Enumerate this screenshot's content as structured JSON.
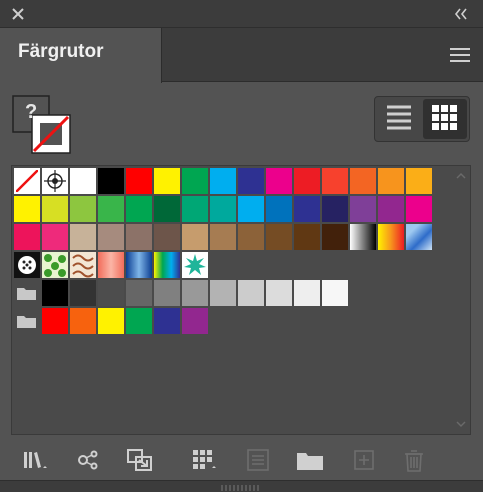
{
  "panel": {
    "title": "Färgrutor"
  },
  "icons": {
    "close": "close-icon",
    "collapse": "double-chevron-icon",
    "menu": "hamburger-menu-icon",
    "list_view": "list-view-icon",
    "grid_view": "grid-view-icon",
    "unknown_fill": "question-mark-icon"
  },
  "fill_stroke": {
    "fill_label": "?"
  },
  "swatch_rows": [
    [
      "none",
      "registration",
      "#ffffff",
      "#000000",
      "#ff0000",
      "#fff200",
      "#00a651",
      "#00aeef",
      "#2e3192",
      "#ec008c",
      "#ed1c24",
      "#f7412d",
      "#f36523",
      "#f7941d",
      "#fbae17"
    ],
    [
      "#fff200",
      "#d7df23",
      "#8dc63f",
      "#39b54a",
      "#00a651",
      "#006838",
      "#00a775",
      "#00a99d",
      "#00aeef",
      "#0072bc",
      "#2e3192",
      "#262262",
      "#7f3f98",
      "#92278f",
      "#ec008c"
    ],
    [
      "#ed145b",
      "#ee2a7b",
      "#c7b299",
      "#a68b7e",
      "#8c7268",
      "#6d554a",
      "#c69c6d",
      "#a67c52",
      "#8c6239",
      "#754c24",
      "#603813",
      "#42210b",
      "grad-bw",
      "grad-orange",
      "grad-checker"
    ],
    [
      "pattern-dots",
      "pattern-green",
      "pattern-brown",
      "grad-salmon",
      "grad-blue",
      "grad-rainbow",
      "pattern-star"
    ],
    [
      "folder",
      "#000000",
      "#333333",
      "#4d4d4d",
      "#666666",
      "#808080",
      "#999999",
      "#b3b3b3",
      "#cccccc",
      "#dcdcdc",
      "#eeeeee",
      "#f7f7f7"
    ],
    [
      "folder",
      "#ff0000",
      "#f7620e",
      "#fff200",
      "#00a651",
      "#2e3192",
      "#92278f"
    ]
  ],
  "bottom_tools": [
    "swatch-libraries-icon",
    "swatch-kinds-icon",
    "place-swatches-icon",
    "swatch-options-icon",
    "color-group-icon",
    "new-color-group-icon",
    "new-swatch-icon",
    "delete-swatch-icon"
  ]
}
